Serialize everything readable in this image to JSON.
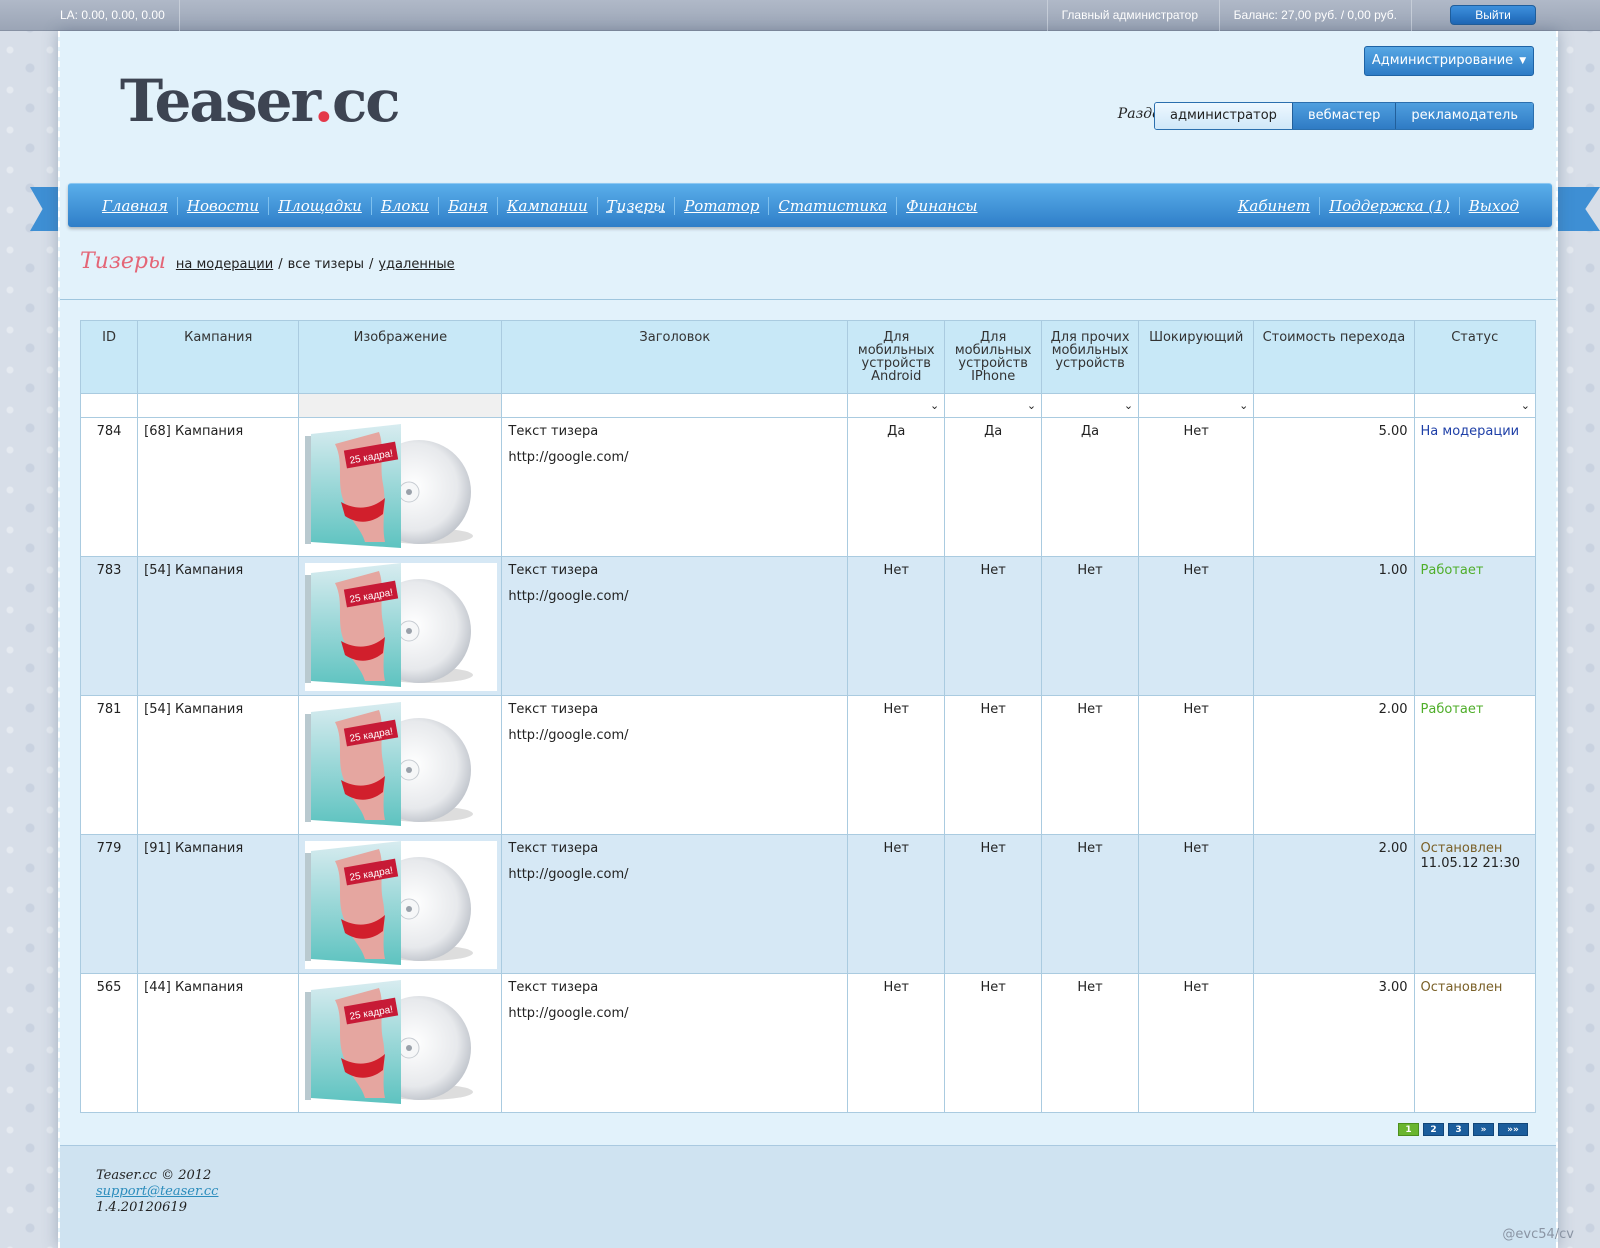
{
  "topbar": {
    "load_average": "LA: 0.00, 0.00, 0.00",
    "role": "Главный администратор",
    "balance": "Баланс: 27,00 руб. / 0,00 руб.",
    "logout_label": "Выйти"
  },
  "header": {
    "logo_text": "Teaser",
    "logo_dot": ".",
    "logo_tld": "cc",
    "admin_dropdown_label": "Администрирование",
    "section_label": "Раздел:",
    "section_tabs": [
      "администратор",
      "вебмастер",
      "рекламодатель"
    ],
    "active_section": "администратор"
  },
  "nav": {
    "left": [
      "Главная",
      "Новости",
      "Площадки",
      "Блоки",
      "Баня",
      "Кампании",
      "Тизеры",
      "Ротатор",
      "Статистика",
      "Финансы"
    ],
    "right": [
      "Кабинет",
      "Поддержка (1)",
      "Выход"
    ],
    "current": "Тизеры"
  },
  "page": {
    "title": "Тизеры",
    "filters": {
      "moderation": "на модерации",
      "separator": "/",
      "all": "все тизеры",
      "deleted": "удаленные"
    }
  },
  "table": {
    "columns": [
      "ID",
      "Кампания",
      "Изображение",
      "Заголовок",
      "Для мобильных устройств Android",
      "Для мобильных устройств IPhone",
      "Для прочих мобильных устройств",
      "Шокирующий",
      "Стоимость перехода",
      "Статус"
    ],
    "rows": [
      {
        "id": "784",
        "campaign": "[68] Кампания",
        "headline": "Текст тизера",
        "url": "http://google.com/",
        "android": "Да",
        "iphone": "Да",
        "other": "Да",
        "shocking": "Нет",
        "price": "5.00",
        "status": "На модерации",
        "status_date": ""
      },
      {
        "id": "783",
        "campaign": "[54] Кампания",
        "headline": "Текст тизера",
        "url": "http://google.com/",
        "android": "Нет",
        "iphone": "Нет",
        "other": "Нет",
        "shocking": "Нет",
        "price": "1.00",
        "status": "Работает",
        "status_date": ""
      },
      {
        "id": "781",
        "campaign": "[54] Кампания",
        "headline": "Текст тизера",
        "url": "http://google.com/",
        "android": "Нет",
        "iphone": "Нет",
        "other": "Нет",
        "shocking": "Нет",
        "price": "2.00",
        "status": "Работает",
        "status_date": ""
      },
      {
        "id": "779",
        "campaign": "[91] Кампания",
        "headline": "Текст тизера",
        "url": "http://google.com/",
        "android": "Нет",
        "iphone": "Нет",
        "other": "Нет",
        "shocking": "Нет",
        "price": "2.00",
        "status": "Остановлен",
        "status_date": "11.05.12 21:30"
      },
      {
        "id": "565",
        "campaign": "[44] Кампания",
        "headline": "Текст тизера",
        "url": "http://google.com/",
        "android": "Нет",
        "iphone": "Нет",
        "other": "Нет",
        "shocking": "Нет",
        "price": "3.00",
        "status": "Остановлен",
        "status_date": ""
      }
    ],
    "thumbnail_caption": "25 кадра!"
  },
  "pager": {
    "pages": [
      "1",
      "2",
      "3"
    ],
    "next": "»",
    "last": "»»",
    "current_page": "1"
  },
  "footer": {
    "copyright": "Teaser.cc © 2012",
    "email": "support@teaser.cc",
    "version": "1.4.20120619"
  },
  "watermark": "@evc54/cv",
  "colors": {
    "accent_blue": "#2f7ec8",
    "title_pink": "#e46576",
    "status_moderation": "#1e3fa7",
    "status_running": "#4fae2a",
    "status_stopped": "#7a6028",
    "pager_active": "#6ab52e"
  }
}
